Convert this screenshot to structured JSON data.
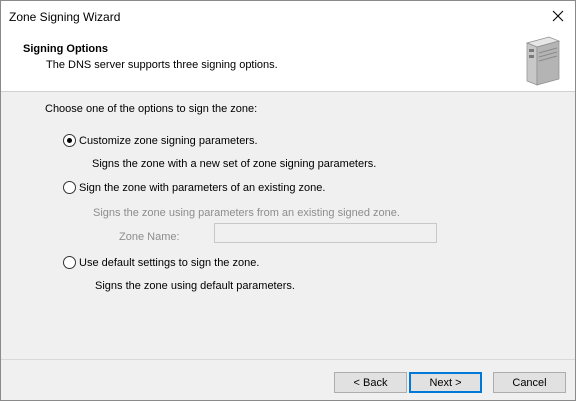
{
  "window": {
    "title": "Zone Signing Wizard"
  },
  "header": {
    "title": "Signing Options",
    "subtitle": "The DNS server supports three signing options."
  },
  "main": {
    "prompt": "Choose one of the options to sign the zone:",
    "options": [
      {
        "label": "Customize zone signing parameters.",
        "description": "Signs the zone with a new set of zone signing parameters.",
        "selected": true
      },
      {
        "label": "Sign the zone with parameters of an existing zone.",
        "description": "Signs the zone using parameters from an existing signed zone.",
        "selected": false
      },
      {
        "label": "Use default settings to sign the zone.",
        "description": "Signs the zone using default parameters.",
        "selected": false
      }
    ],
    "zone_name": {
      "label": "Zone Name:",
      "value": ""
    }
  },
  "buttons": {
    "back": "< Back",
    "next": "Next >",
    "cancel": "Cancel"
  },
  "icons": {
    "close": "close-icon",
    "server": "server-icon"
  }
}
